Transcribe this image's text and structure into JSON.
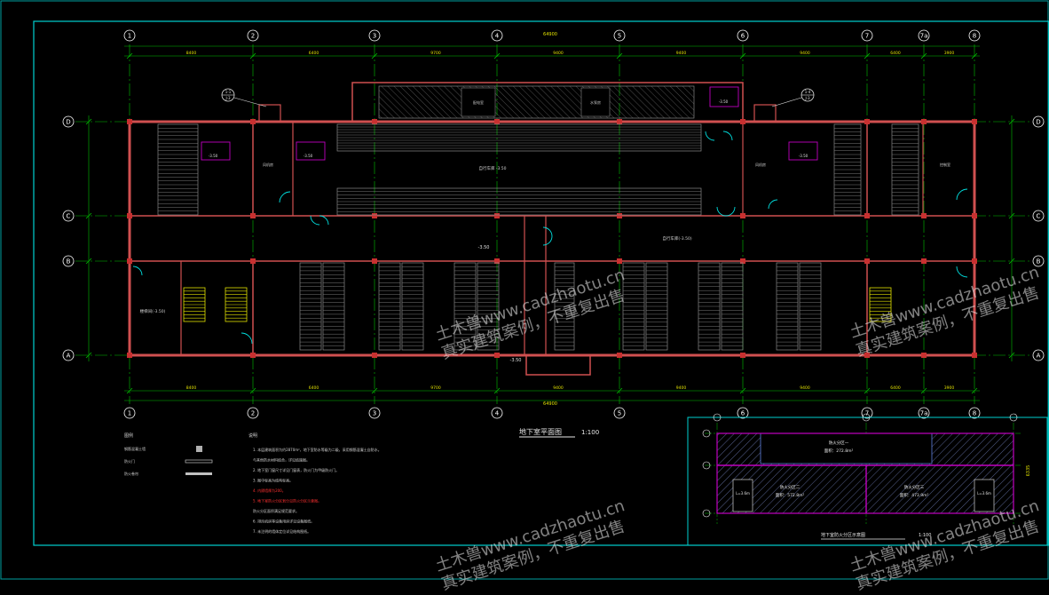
{
  "drawing": {
    "main_title": "地下室平面图",
    "main_scale": "1:100",
    "sub_title": "地下室防火分区示意图",
    "sub_scale": "1:100",
    "overall_dimension": "64900",
    "right_dimension": "6335"
  },
  "axes": {
    "columns": [
      "1",
      "2",
      "3",
      "4",
      "5",
      "6",
      "7",
      "7a",
      "8"
    ],
    "rows": [
      "D",
      "C",
      "B",
      "A"
    ]
  },
  "dims_top": [
    "8400",
    "6400",
    "9700",
    "9400",
    "9400",
    "9400",
    "6400",
    "3900"
  ],
  "dims_bottom": [
    "8400",
    "6400",
    "9700",
    "9400",
    "9400",
    "9400",
    "6400",
    "3900"
  ],
  "rooms": {
    "central_hall": "自行车库 -3.50",
    "east_hall": "自行车库(-3.50)",
    "west_stair": "楼梯间(-3.50)",
    "level_mark": "-3.50",
    "equip_room_1": "配电室",
    "equip_room_2": "水泵房",
    "equip_room_3": "风机房",
    "equip_room_4": "控制室"
  },
  "callouts": {
    "left": [
      "1-1",
      "J-3"
    ],
    "right": [
      "1-4",
      "J-3"
    ]
  },
  "legend": {
    "heading": "图例",
    "items": [
      "钢筋混凝土墙",
      "防火门",
      "防火卷帘"
    ]
  },
  "notes": {
    "heading": "说明",
    "lines": [
      "1. 本层建筑面积为约2870m²，地下室防水等级为二级，采用钢筋混凝土自防水。",
      "   与其他防水材料结合，详见结施图。",
      "2. 地下室门窗尺寸详见门窗表，防火门为甲级防火门。",
      "3. 图中标高为结构标高。",
      "4. 内隔墙厚为200。",
      "5. 地下室防火分区划分见防火分区示意图。",
      "   防火分区面积满足规范要求。",
      "6. 排风机房等设备用房详见设备图纸。",
      "7. 未注明的墙体定位详见结构图纸。"
    ],
    "red_lines": [
      4,
      5
    ]
  },
  "fire_zones": {
    "zone1": "防火分区一",
    "zone1_area": "面积：272.8m²",
    "zone2": "防火分区二",
    "zone2_area": "面积：572.8m²",
    "zone3": "防火分区三",
    "zone3_area": "面积：473.9m²",
    "exit_left": "L=3.6m",
    "exit_right": "L=3.6m"
  },
  "watermark": {
    "line1": "土木兽www.cadzhaotu.cn",
    "line2": "真实建筑案例，不重复出售"
  },
  "colors": {
    "background": "#000000",
    "wall": "#d05050",
    "axis": "#00c000",
    "dimension": "#e0e000",
    "frame": "#00d0d0",
    "bubble": "#ffffff",
    "stair": "#e0e000",
    "fire_zone_boundary": "#c000c0",
    "fire_zone_hatch": "#6080e0"
  }
}
